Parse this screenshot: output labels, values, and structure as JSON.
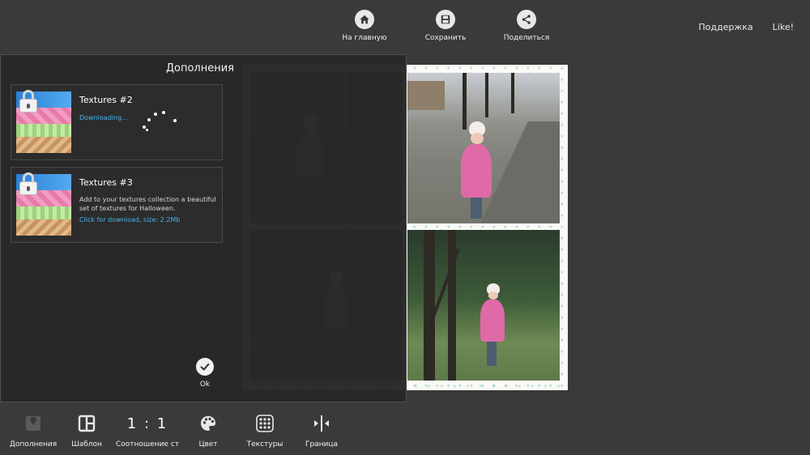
{
  "top_bar": {
    "actions": [
      {
        "label": "На главную",
        "icon": "home-icon"
      },
      {
        "label": "Сохранить",
        "icon": "save-icon"
      },
      {
        "label": "Поделиться",
        "icon": "share-icon"
      }
    ],
    "support_label": "Поддержка",
    "like_label": "Like!"
  },
  "addons_panel": {
    "title": "Дополнения",
    "items": [
      {
        "name": "Textures #2",
        "status": "Downloading..."
      },
      {
        "name": "Textures #3",
        "description": "Add to your textures collection a beautiful set of textures for Halloween.",
        "link": "Click for download, size:  2.2Mb"
      }
    ],
    "ok_label": "Ok"
  },
  "bottom_bar": {
    "items": [
      {
        "label": "Дополнения",
        "icon": "addons-download-icon"
      },
      {
        "label": "Шаблон",
        "icon": "template-icon"
      },
      {
        "label": "Соотношение ст",
        "icon": "ratio-icon",
        "text": "1 : 1"
      },
      {
        "label": "Цвет",
        "icon": "palette-icon"
      },
      {
        "label": "Текстуры",
        "icon": "textures-icon"
      },
      {
        "label": "Граница",
        "icon": "border-icon"
      }
    ]
  },
  "colors": {
    "background": "#3a3a3a",
    "panel": "#282828",
    "link": "#4ab5ee",
    "coat": "#e06aa8"
  }
}
